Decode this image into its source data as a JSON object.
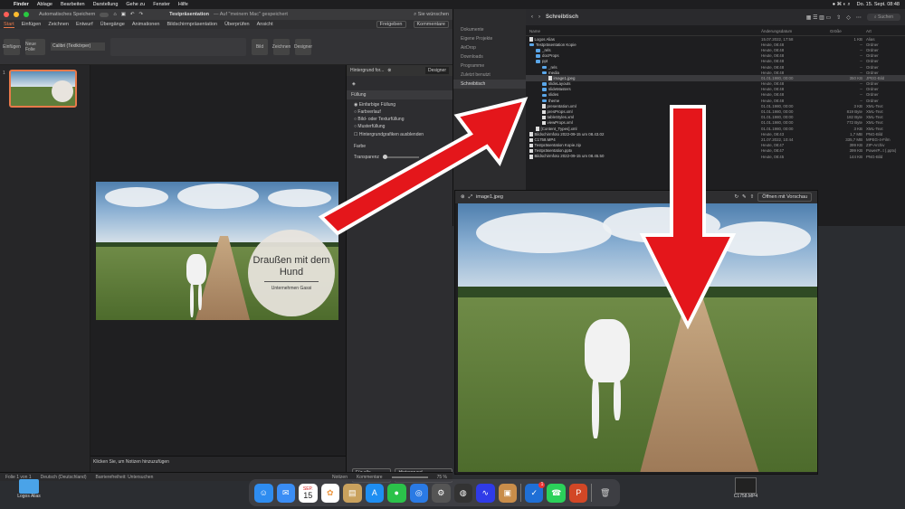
{
  "menubar": {
    "apple": "",
    "items": [
      "Finder",
      "Ablage",
      "Bearbeiten",
      "Darstellung",
      "Gehe zu",
      "Fenster",
      "Hilfe"
    ],
    "datetime": "Do. 15. Sept. 08:48"
  },
  "ppt": {
    "autosave": "Automatisches Speichern",
    "title": "Testpräsentation",
    "title_suffix": "— Auf \"meinem Mac\" gespeichert",
    "search": "Sie wünschen",
    "tabs": [
      "Start",
      "Einfügen",
      "Zeichnen",
      "Entwurf",
      "Übergänge",
      "Animationen",
      "Bildschirmpräsentation",
      "Überprüfen",
      "Ansicht"
    ],
    "share": "Freigeben",
    "comments": "Kommentare",
    "font": "Calibri (Textkörper)",
    "ribbon_buttons": [
      "Einfügen",
      "Neue Folie",
      "Bild",
      "Zeichnen",
      "Designer"
    ],
    "slide_title": "Draußen mit dem Hund",
    "slide_subtitle": "Unternehmen Gassi",
    "notes_placeholder": "Klicken Sie, um Notizen hinzuzufügen",
    "pane": {
      "header": "Hintergrund for...",
      "designer": "Designer",
      "section": "Füllung",
      "options": [
        "Einfarbige Füllung",
        "Farbverlauf",
        "Bild- oder Texturfüllung",
        "Musterfüllung"
      ],
      "hide_graphics": "Hintergrundgrafiken ausblenden",
      "color": "Farbe",
      "transparency": "Transparenz",
      "apply_all": "Für alle überm...",
      "reset": "Hintergrund zurücksetzen"
    },
    "status": {
      "slide": "Folie 1 von 1",
      "language": "Deutsch (Deutschland)",
      "accessibility": "Barrierefreiheit: Untersuchen",
      "notes": "Notizen",
      "comments": "Kommentare",
      "zoom": "75 %"
    }
  },
  "finder": {
    "title": "Schreibtisch",
    "search": "Suchen",
    "sidebar": [
      "Dokumente",
      "Eigene Projekte",
      "AirDrop",
      "Downloads",
      "Programme",
      "Zuletzt benutzt",
      "Schreibtisch"
    ],
    "columns": [
      "Name",
      "Änderungsdatum",
      "Größe",
      "Art"
    ],
    "rows": [
      {
        "name": "Logos Alias",
        "date": "15.07.2022, 17:58",
        "size": "1 KB",
        "kind": "Alias",
        "folder": false,
        "indent": 0
      },
      {
        "name": "Testpräsentation Kopie",
        "date": "Heute, 08:48",
        "size": "--",
        "kind": "Ordner",
        "folder": true,
        "indent": 0
      },
      {
        "name": "_rels",
        "date": "Heute, 08:48",
        "size": "--",
        "kind": "Ordner",
        "folder": true,
        "indent": 1
      },
      {
        "name": "docProps",
        "date": "Heute, 08:48",
        "size": "--",
        "kind": "Ordner",
        "folder": true,
        "indent": 1
      },
      {
        "name": "ppt",
        "date": "Heute, 08:48",
        "size": "--",
        "kind": "Ordner",
        "folder": true,
        "indent": 1
      },
      {
        "name": "_rels",
        "date": "Heute, 08:48",
        "size": "--",
        "kind": "Ordner",
        "folder": true,
        "indent": 2
      },
      {
        "name": "media",
        "date": "Heute, 08:48",
        "size": "--",
        "kind": "Ordner",
        "folder": true,
        "indent": 2
      },
      {
        "name": "image1.jpeg",
        "date": "01.01.1980, 00:00",
        "size": "350 KB",
        "kind": "JPEG-Bild",
        "folder": false,
        "indent": 3,
        "selected": true
      },
      {
        "name": "slideLayouts",
        "date": "Heute, 08:48",
        "size": "--",
        "kind": "Ordner",
        "folder": true,
        "indent": 2
      },
      {
        "name": "slideMasters",
        "date": "Heute, 08:48",
        "size": "--",
        "kind": "Ordner",
        "folder": true,
        "indent": 2
      },
      {
        "name": "slides",
        "date": "Heute, 08:48",
        "size": "--",
        "kind": "Ordner",
        "folder": true,
        "indent": 2
      },
      {
        "name": "theme",
        "date": "Heute, 08:48",
        "size": "--",
        "kind": "Ordner",
        "folder": true,
        "indent": 2
      },
      {
        "name": "presentation.xml",
        "date": "01.01.1980, 00:00",
        "size": "3 KB",
        "kind": "XML-Text",
        "folder": false,
        "indent": 2
      },
      {
        "name": "presProps.xml",
        "date": "01.01.1980, 00:00",
        "size": "819 Byte",
        "kind": "XML-Text",
        "folder": false,
        "indent": 2
      },
      {
        "name": "tableStyles.xml",
        "date": "01.01.1980, 00:00",
        "size": "182 Byte",
        "kind": "XML-Text",
        "folder": false,
        "indent": 2
      },
      {
        "name": "viewProps.xml",
        "date": "01.01.1980, 00:00",
        "size": "772 Byte",
        "kind": "XML-Text",
        "folder": false,
        "indent": 2
      },
      {
        "name": "[Content_Types].xml",
        "date": "01.01.1980, 00:00",
        "size": "3 KB",
        "kind": "XML-Text",
        "folder": false,
        "indent": 1
      },
      {
        "name": "Bildschirmfoto 2022-09-15 um 08.43.02",
        "date": "Heute, 08:43",
        "size": "1,7 MB",
        "kind": "PNG-Bild",
        "folder": false,
        "indent": 0
      },
      {
        "name": "C1758.MP4",
        "date": "21.07.2022, 10:44",
        "size": "335,7 MB",
        "kind": "MPEG-4-Film",
        "folder": false,
        "indent": 0
      },
      {
        "name": "Testpräsentation Kopie.zip",
        "date": "Heute, 08:47",
        "size": "399 KB",
        "kind": "ZIP-Archiv",
        "folder": false,
        "indent": 0
      },
      {
        "name": "Testpräsentation.pptx",
        "date": "Heute, 08:47",
        "size": "399 KB",
        "kind": "PowerP...t (.pptx)",
        "folder": false,
        "indent": 0
      },
      {
        "name": "Bildschirmfoto 2022-09-15 um 08.45.50",
        "date": "Heute, 08:45",
        "size": "144 KB",
        "kind": "PNG-Bild",
        "folder": false,
        "indent": 0
      }
    ]
  },
  "preview": {
    "title": "image1.jpeg",
    "open_with": "Öffnen mit Vorschau"
  },
  "desktop": {
    "logos_alias": "Logos Alias",
    "video": "C1758.MP4"
  },
  "dock": {
    "calendar_month": "SEP.",
    "calendar_day": "15",
    "mail_badge": "1"
  },
  "colors": {
    "accent": "#e8794a",
    "arrow": "#e4161b",
    "finder_folder": "#5aa6e8"
  }
}
